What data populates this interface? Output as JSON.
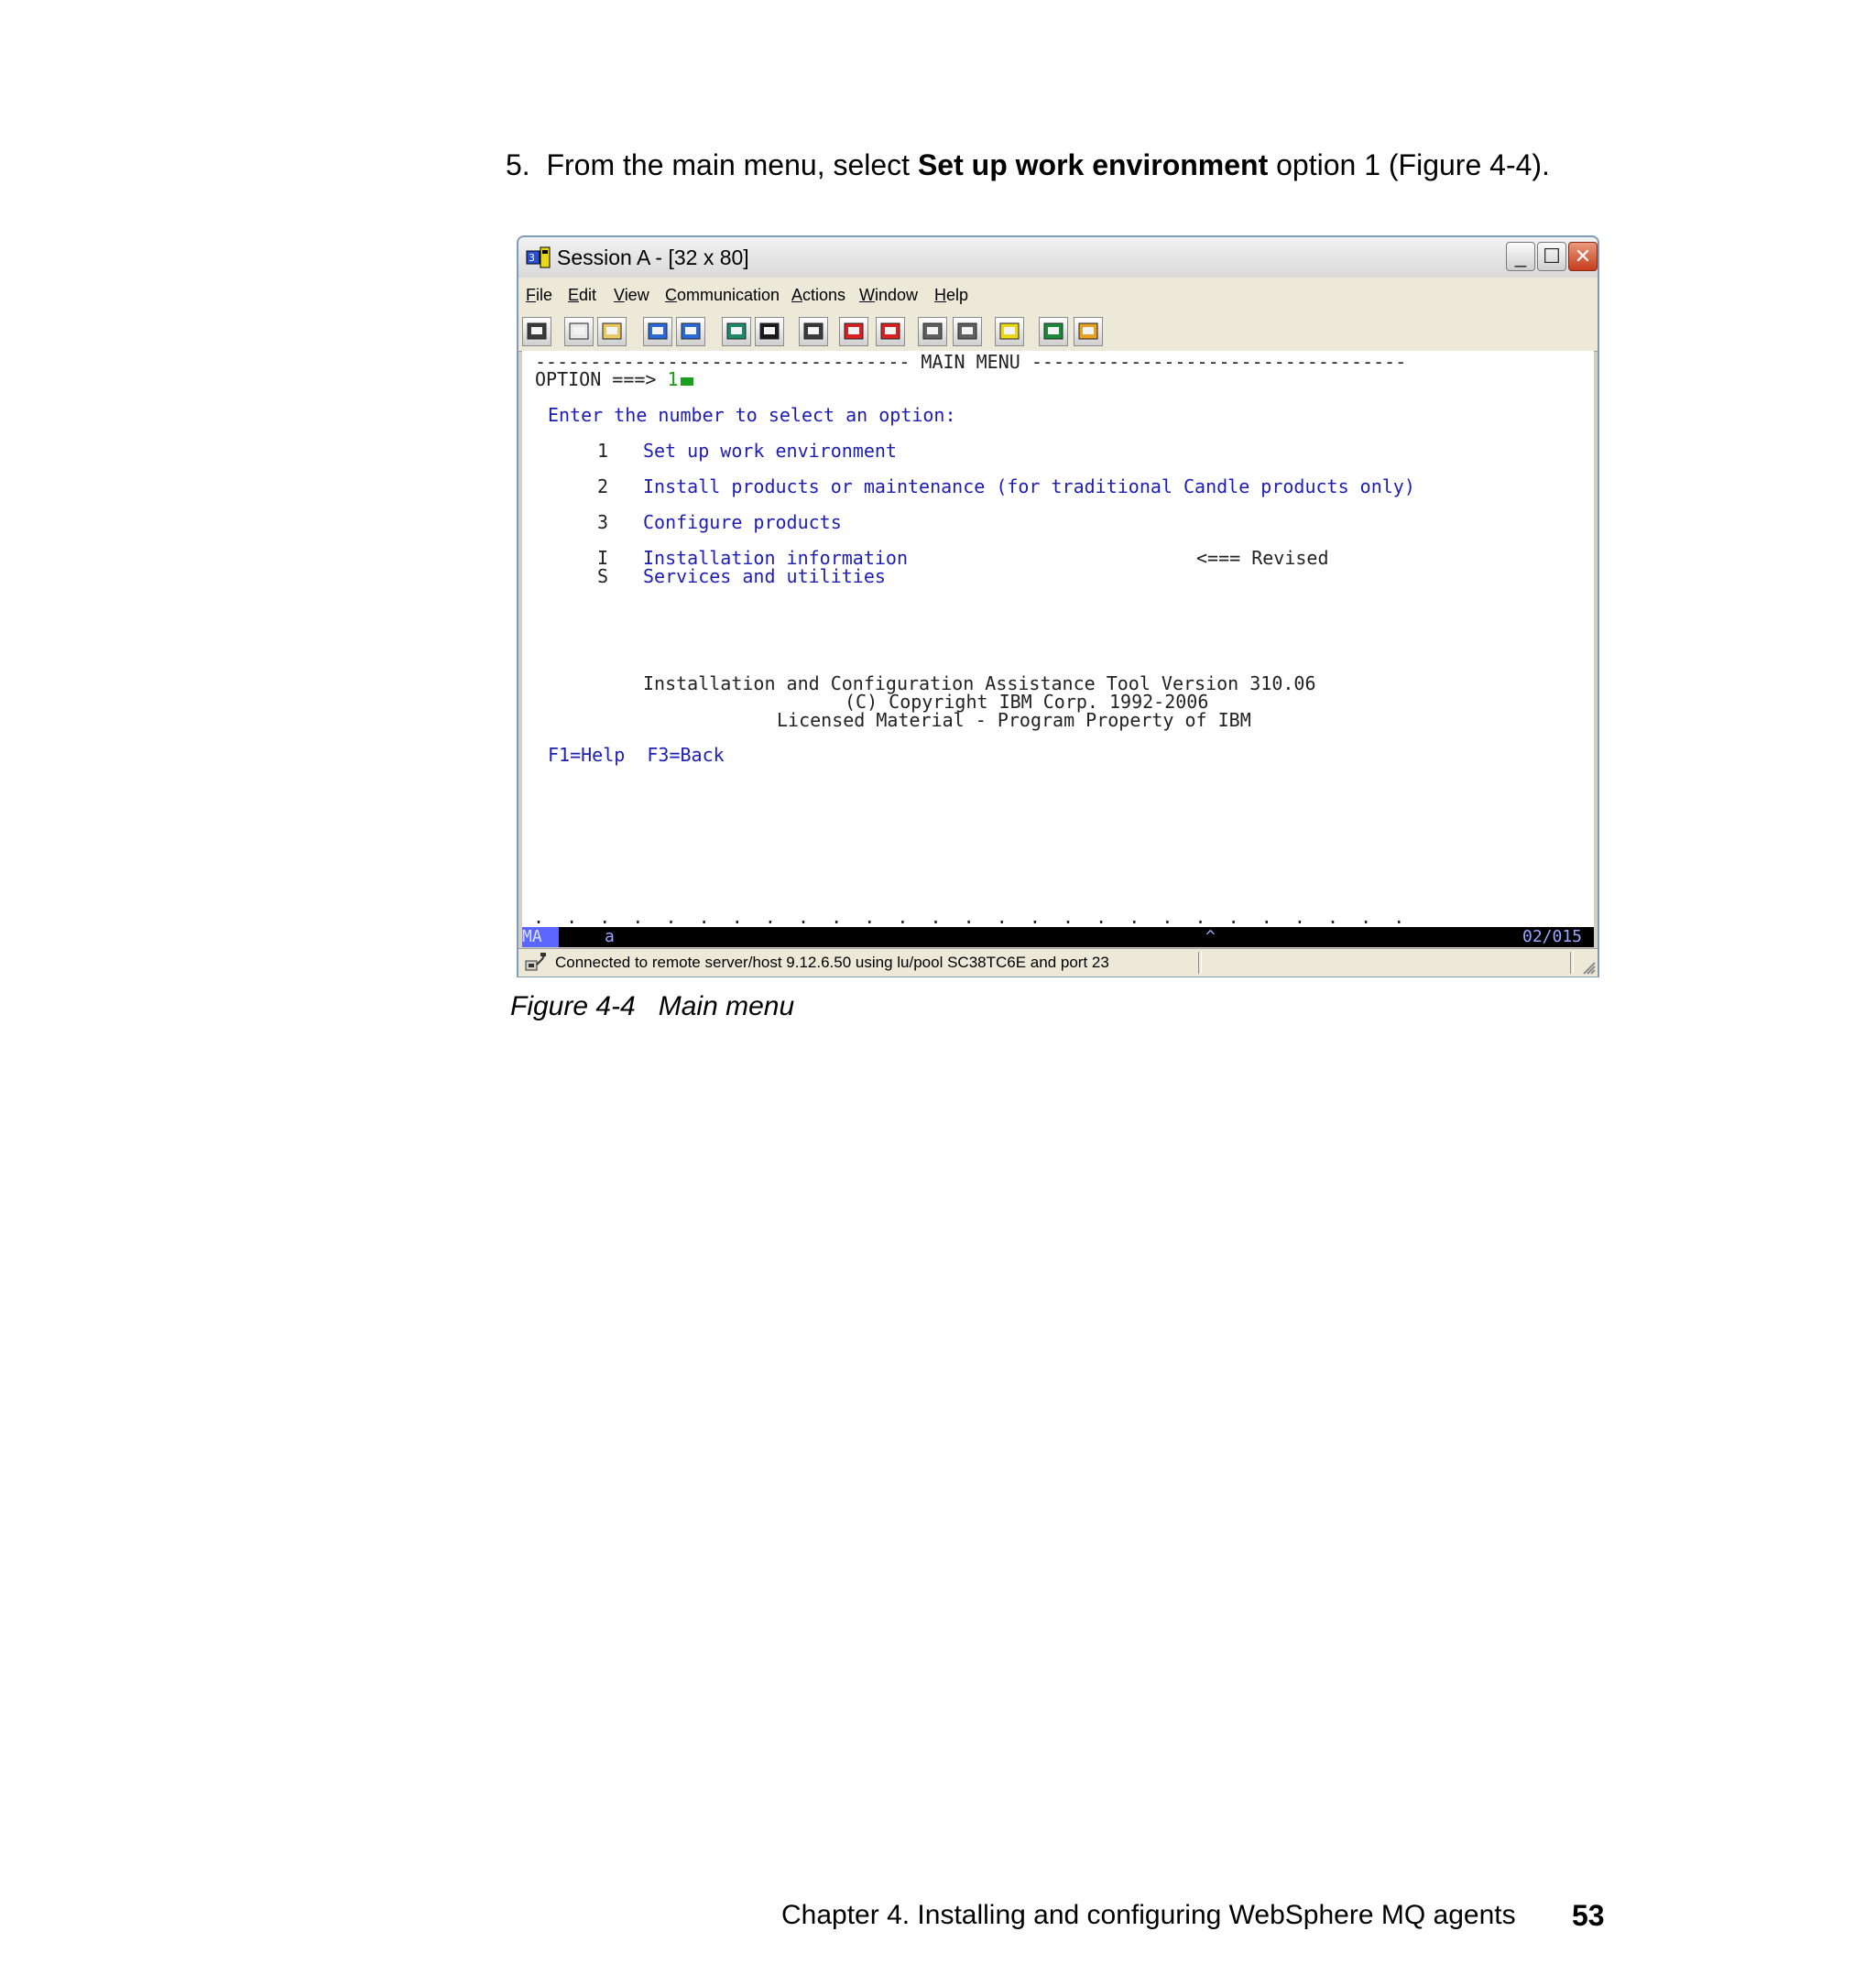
{
  "step": {
    "number": "5.",
    "prefix": "From the main menu, select",
    "bold": "Set up work environment",
    "suffix": "option 1 (Figure 4-4)."
  },
  "window": {
    "title": "Session A - [32 x 80]",
    "menus": [
      "File",
      "Edit",
      "View",
      "Communication",
      "Actions",
      "Window",
      "Help"
    ],
    "mnemonics": [
      "F",
      "E",
      "V",
      "C",
      "A",
      "W",
      "H"
    ],
    "toolbar_icons": [
      "screen-icon",
      "copy-icon",
      "paste-icon",
      "send-file-icon",
      "receive-file-icon",
      "display-icon",
      "display-setup-icon",
      "keyboard-icon",
      "macro-record-icon",
      "macro-stop-icon",
      "macro-play-icon",
      "macro-options-icon",
      "clipboard-icon",
      "web-icon",
      "tag-icon"
    ],
    "close_glyph": "✕",
    "minimize_glyph": "_",
    "maximize_glyph": "☐"
  },
  "terminal": {
    "header_line": "---------------------------------- MAIN MENU ----------------------------------",
    "option_prompt": "OPTION ===>",
    "option_value": "1",
    "instruction": "Enter the number to select an option:",
    "options": [
      {
        "key": "1",
        "label": "Set up work environment"
      },
      {
        "key": "2",
        "label": "Install products or maintenance (for traditional Candle products only)"
      },
      {
        "key": "3",
        "label": "Configure products"
      },
      {
        "key": "I",
        "label": "Installation information"
      },
      {
        "key": "S",
        "label": "Services and utilities"
      }
    ],
    "revised_note": "<=== Revised",
    "tool_line": "Installation and Configuration Assistance Tool Version 310.06",
    "copyright_line": "(C) Copyright IBM Corp. 1992-2006",
    "license_line": "Licensed Material - Program Property of IBM",
    "function_keys": "F1=Help  F3=Back",
    "dots_line": ".  .  .  .  .  .  .  .  .  .  .  .  .  .  .  .  .  .  .  .  .  .  .  .  .  .  .",
    "oia": {
      "mode": "MA",
      "session": "a",
      "indicator": "^",
      "cursor_pos": "02/015"
    }
  },
  "status": {
    "text": "Connected to remote server/host 9.12.6.50 using lu/pool SC38TC6E and port 23"
  },
  "caption": {
    "label": "Figure 4-4",
    "title": "Main menu"
  },
  "footer": {
    "chapter": "Chapter 4. Installing and configuring WebSphere MQ agents",
    "page": "53"
  }
}
